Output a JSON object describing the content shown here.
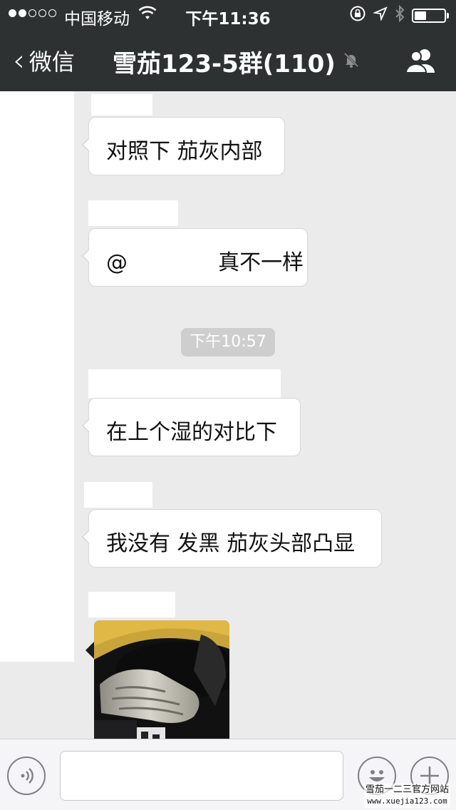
{
  "status_bar": {
    "carrier": "中国移动",
    "time": "下午11:36",
    "signal_strength": 2,
    "battery_level": 0.45
  },
  "nav": {
    "back_label": "微信",
    "chat_title": "雪茄123-5群(110)",
    "muted_icon": "bell-off-icon",
    "members_icon": "group-members-icon"
  },
  "messages": [
    {
      "type": "text",
      "text": "对照下 茄灰内部"
    },
    {
      "type": "text",
      "mention": "@",
      "text": "真不一样"
    },
    {
      "type": "time",
      "text": "下午10:57"
    },
    {
      "type": "text",
      "text": "在上个湿的对比下"
    },
    {
      "type": "text",
      "text": "我没有 发黑 茄灰头部凸显"
    },
    {
      "type": "image",
      "text": "cigar ash photo"
    }
  ],
  "input_bar": {
    "voice_icon": "voice-icon",
    "emoji_icon": "emoji-icon",
    "plus_icon": "plus-icon",
    "placeholder": ""
  },
  "watermark": {
    "name": "雪茄一二三官方网站",
    "url": "www.xuejia123.com"
  }
}
